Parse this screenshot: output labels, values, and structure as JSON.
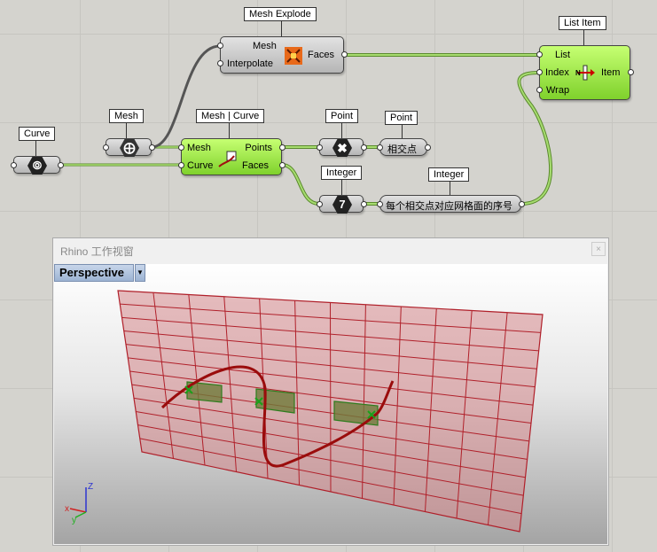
{
  "canvas": {
    "curve_param": {
      "tag": "Curve"
    },
    "mesh_param": {
      "tag": "Mesh"
    },
    "mesh_curve": {
      "tag": "Mesh | Curve",
      "in_mesh": "Mesh",
      "in_curve": "Curve",
      "out_points": "Points",
      "out_faces": "Faces"
    },
    "mesh_explode": {
      "tag": "Mesh Explode",
      "in_mesh": "Mesh",
      "in_interp": "Interpolate",
      "out_faces": "Faces"
    },
    "list_item": {
      "tag": "List Item",
      "in_list": "List",
      "in_index": "Index",
      "in_wrap": "Wrap",
      "out_item": "Item"
    },
    "point_param": {
      "tag": "Point"
    },
    "point_panel": {
      "tag": "Point",
      "text": "相交点"
    },
    "integer_param": {
      "tag": "Integer",
      "icon_digit": "7"
    },
    "integer_panel": {
      "tag": "Integer",
      "text": "每个相交点对应网格面的序号"
    }
  },
  "rhino": {
    "window_title": "Rhino 工作视窗",
    "close_label": "×",
    "viewport_name": "Perspective",
    "dropdown_glyph": "▼",
    "axis_x": "x",
    "axis_y": "y",
    "axis_z": "Z"
  },
  "colors": {
    "mesh": "#b0202a",
    "mesh_fill": "#d3868b",
    "highlight": "#2e7d1e",
    "wire": "#8fc25c"
  }
}
